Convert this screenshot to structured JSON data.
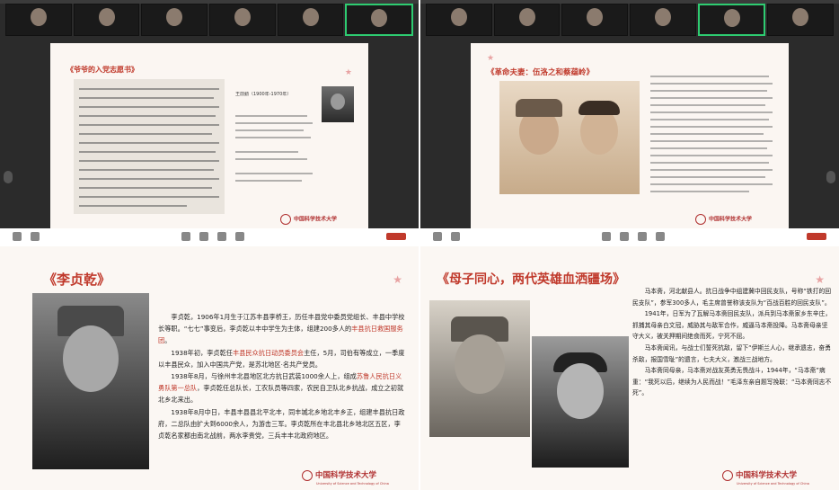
{
  "panel_top_left": {
    "slide_title": "《爷爷的入党志愿书》",
    "caption_name": "王前勤（1900年-1970年）",
    "logo_text": "中国科学技术大学"
  },
  "panel_top_right": {
    "slide_title": "《革命夫妻：伍洛之和蔡蕴岭》",
    "logo_text": "中国科学技术大学"
  },
  "panel_bottom_left": {
    "slide_title": "《李贞乾》",
    "paragraphs": [
      {
        "text": "李贞乾，1906年1月生于江苏丰县李桥王，历任丰县党中委员党组长、丰县中学校长等职。“七七”事变后，李贞乾以丰中学生为主体，组建200多人的",
        "highlight": "丰县抗日救国服务团",
        "after": "。"
      },
      {
        "text": "1938年初，李贞乾任",
        "highlight": "丰县民众抗日动员委员会",
        "after": "主任，5月，司伯有等成立，一季度以丰县民众，加入中国共产党，是苏北地区·名共产党员。"
      },
      {
        "text": "1938年8月，与徐州丰北县地区北方抗日武装1000余人上，组成",
        "highlight": "苏鲁人民抗日义勇队第一总队",
        "after": "，李贞乾任总队长，工农队员等四家，农民自卫队北乡抗战，成立之初就北乡北来出。"
      },
      {
        "text": "1938年8月中日，丰县丰县县北平北丰，同丰城北乡地北丰乡正，组建丰县抗日政府，二总队由扩大到6000余人，为游击三军。李贞乾所在丰北县北乡地北区五区，李贞乾名家都由南北战前，两水李贵党，三兵丰丰北政府地区。"
      }
    ],
    "logo_text": "中国科学技术大学",
    "logo_sub": "University of Science and Technology of China"
  },
  "panel_bottom_right": {
    "slide_title": "《母子同心，两代英雄血洒疆场》",
    "paragraphs": [
      {
        "text": "马本斋，河北献县人。抗日战争中组建冀中回民支队，号称“铁打的回民支队”，参军300多人，毛主席曾誉称该支队为“百战百胜的回民支队”。"
      },
      {
        "text": "1941年，日军为了瓦解马本斋回民支队，派兵到马本斋家乡东辛庄，抓捕其母亲白文冠，威胁其与敌军合作，威逼马本斋投降。马本斋母亲坚守大义，被关押期间绝食而死，宁死不屈。"
      },
      {
        "text": "马本斋闻讯，与战士们誓死抗敌，留下“伊斯兰人心，继承遗志，奋勇杀敌，报国雪耻”的遗言，七夫大义，激战三战地方。"
      },
      {
        "text": "马本斋同母亲，马本斋对战友英勇无畏战斗，1944年，“马本斋”病重：“我死以后，继续为人民而战！”毛泽东亲自题写挽联：“马本斋同志不死”。"
      }
    ],
    "logo_text": "中国科学技术大学",
    "logo_sub": "University of Science and Technology of China"
  },
  "colors": {
    "accent_red": "#c0392b",
    "slide_bg": "#fbf6f2",
    "meeting_bg": "#2b2b2b"
  }
}
